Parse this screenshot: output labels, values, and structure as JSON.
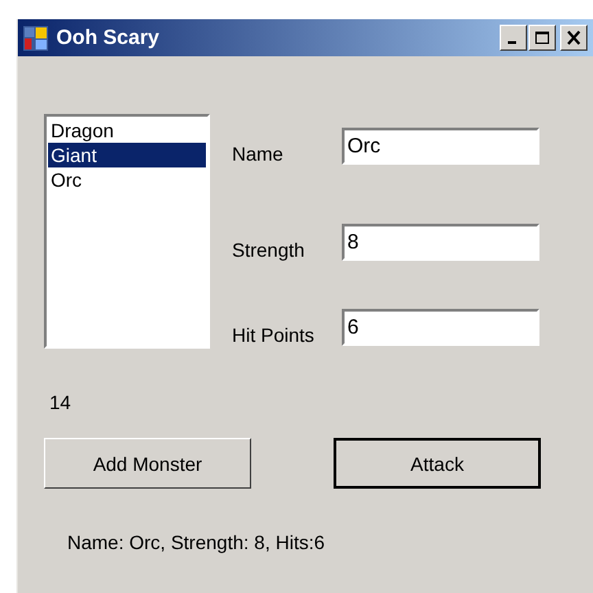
{
  "window": {
    "title": "Ooh Scary"
  },
  "monster_list": [
    {
      "label": "Dragon",
      "selected": false
    },
    {
      "label": "Giant",
      "selected": true
    },
    {
      "label": "Orc",
      "selected": false
    }
  ],
  "fields": [
    {
      "label": "Name",
      "value": "Orc"
    },
    {
      "label": "Strength",
      "value": "8"
    },
    {
      "label": "Hit Points",
      "value": "6"
    }
  ],
  "count": "14",
  "buttons": [
    {
      "label": "Add Monster",
      "default": false
    },
    {
      "label": "Attack",
      "default": true
    }
  ],
  "status": "Name: Orc, Strength: 8, Hits:6"
}
